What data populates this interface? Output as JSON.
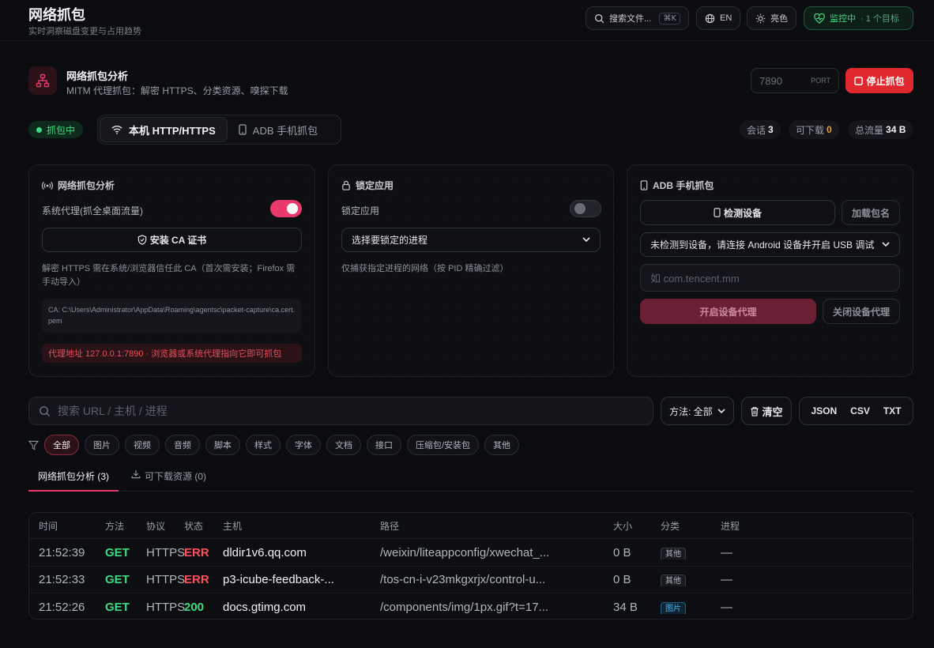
{
  "app": {
    "title": "网络抓包",
    "subtitle": "实时洞察磁盘变更与占用趋势"
  },
  "topbar": {
    "search_label": "搜索文件...",
    "search_shortcut": "⌘K",
    "lang": "EN",
    "theme": "亮色",
    "monitor_label": "监控中",
    "monitor_sub": "· 1 个目标"
  },
  "header": {
    "title": "网络抓包分析",
    "subtitle": "MITM 代理抓包：解密 HTTPS、分类资源、嗅探下载",
    "port_value": "7890",
    "port_label": "PORT",
    "stop_label": "停止抓包"
  },
  "status": {
    "capturing": "抓包中",
    "modes": [
      "本机 HTTP/HTTPS",
      "ADB 手机抓包"
    ],
    "stats": [
      {
        "label": "会话",
        "value": "3"
      },
      {
        "label": "可下载",
        "value": "0"
      },
      {
        "label": "总流量",
        "value": "34 B"
      }
    ]
  },
  "panel_capture": {
    "title": "网络抓包分析",
    "system_proxy_label": "系统代理(抓全桌面流量)",
    "system_proxy_on": true,
    "install_ca_label": "安装 CA 证书",
    "note": "解密 HTTPS 需在系统/浏览器信任此 CA（首次需安装；Firefox 需手动导入）",
    "ca_path": "CA: C:\\Users\\Administrator\\AppData\\Roaming\\agentsc\\packet-capture\\ca.cert.pem",
    "proxy_addr": "代理地址 127.0.0.1:7890 · 浏览器或系统代理指向它即可抓包"
  },
  "panel_lock": {
    "title": "锁定应用",
    "lock_label": "锁定应用",
    "lock_on": false,
    "select_placeholder": "选择要锁定的进程",
    "note": "仅捕获指定进程的网络（按 PID 精确过滤）"
  },
  "panel_adb": {
    "title": "ADB 手机抓包",
    "detect_label": "检测设备",
    "load_pkg_label": "加载包名",
    "device_select": "未检测到设备，请连接 Android 设备并开启 USB 调试",
    "pkg_placeholder": "如 com.tencent.mm",
    "start_proxy_label": "开启设备代理",
    "stop_proxy_label": "关闭设备代理"
  },
  "filters": {
    "search_placeholder": "搜索 URL / 主机 / 进程",
    "method_label": "方法: 全部",
    "clear_label": "清空",
    "exports": [
      "JSON",
      "CSV",
      "TXT"
    ],
    "chips": [
      "全部",
      "图片",
      "视频",
      "音频",
      "脚本",
      "样式",
      "字体",
      "文档",
      "接口",
      "压缩包/安装包",
      "其他"
    ],
    "active_chip": 0
  },
  "tabs": [
    {
      "label": "网络抓包分析 (3)",
      "active": true
    },
    {
      "label": "可下载资源 (0)",
      "active": false
    }
  ],
  "table": {
    "columns": [
      "时间",
      "方法",
      "协议",
      "状态",
      "主机",
      "路径",
      "大小",
      "分类",
      "进程"
    ],
    "rows": [
      {
        "time": "21:52:39",
        "method": "GET",
        "proto": "HTTPS",
        "status": "ERR",
        "host": "dldir1v6.qq.com",
        "path": "/weixin/liteappconfig/xwechat_...",
        "size": "0 B",
        "category": "其他",
        "process": "—"
      },
      {
        "time": "21:52:33",
        "method": "GET",
        "proto": "HTTPS",
        "status": "ERR",
        "host": "p3-icube-feedback-...",
        "path": "/tos-cn-i-v23mkgxrjx/control-u...",
        "size": "0 B",
        "category": "其他",
        "process": "—"
      },
      {
        "time": "21:52:26",
        "method": "GET",
        "proto": "HTTPS",
        "status": "200",
        "host": "docs.gtimg.com",
        "path": "/components/img/1px.gif?t=17...",
        "size": "34 B",
        "category": "图片",
        "process": "—"
      }
    ]
  },
  "colors": {
    "accent": "#e8396a",
    "danger": "#e0282e",
    "success": "#3ddc84",
    "warning": "#f59a2f"
  }
}
